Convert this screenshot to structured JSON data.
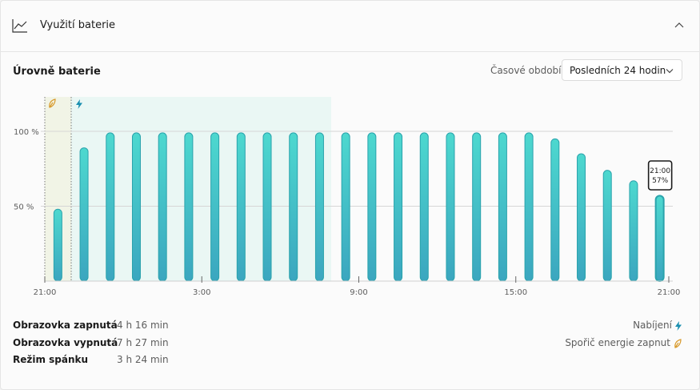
{
  "header": {
    "title": "Využití baterie",
    "icon": "line-chart-icon"
  },
  "section": {
    "title": "Úrovně baterie"
  },
  "period": {
    "label": "Časové období:",
    "selected": "Posledních 24 hodin"
  },
  "chart_data": {
    "type": "bar",
    "y_ticks": [
      "100 %",
      "50 %"
    ],
    "x_ticks": [
      "21:00",
      "3:00",
      "9:00",
      "15:00",
      "21:00"
    ],
    "values": [
      48,
      89,
      99,
      99,
      99,
      99,
      99,
      99,
      99,
      99,
      99,
      99,
      99,
      99,
      99,
      99,
      99,
      99,
      99,
      95,
      85,
      74,
      67,
      57
    ],
    "ylim": [
      0,
      100
    ],
    "tooltip": {
      "time": "21:00",
      "value": "57%"
    },
    "colors": {
      "bar_top": "#4dd8cf",
      "bar_bottom": "#3ba6bf",
      "bar_stroke": "#2aa3ac",
      "charging_bg": "#eaf7f4",
      "saver_bg": "#f1f4e6",
      "saver_icon": "#d89a2c",
      "charge_icon": "#1a8fb0"
    },
    "markers": {
      "saver": "leaf-icon",
      "charging": "bolt-icon"
    }
  },
  "stats": [
    {
      "label": "Obrazovka zapnutá",
      "value": "4 h 16 min"
    },
    {
      "label": "Obrazovka vypnutá",
      "value": "7 h 27 min"
    },
    {
      "label": "Režim spánku",
      "value": "3 h 24 min"
    }
  ],
  "legend": {
    "charging": "Nabíjení",
    "saver": "Spořič energie zapnut"
  }
}
